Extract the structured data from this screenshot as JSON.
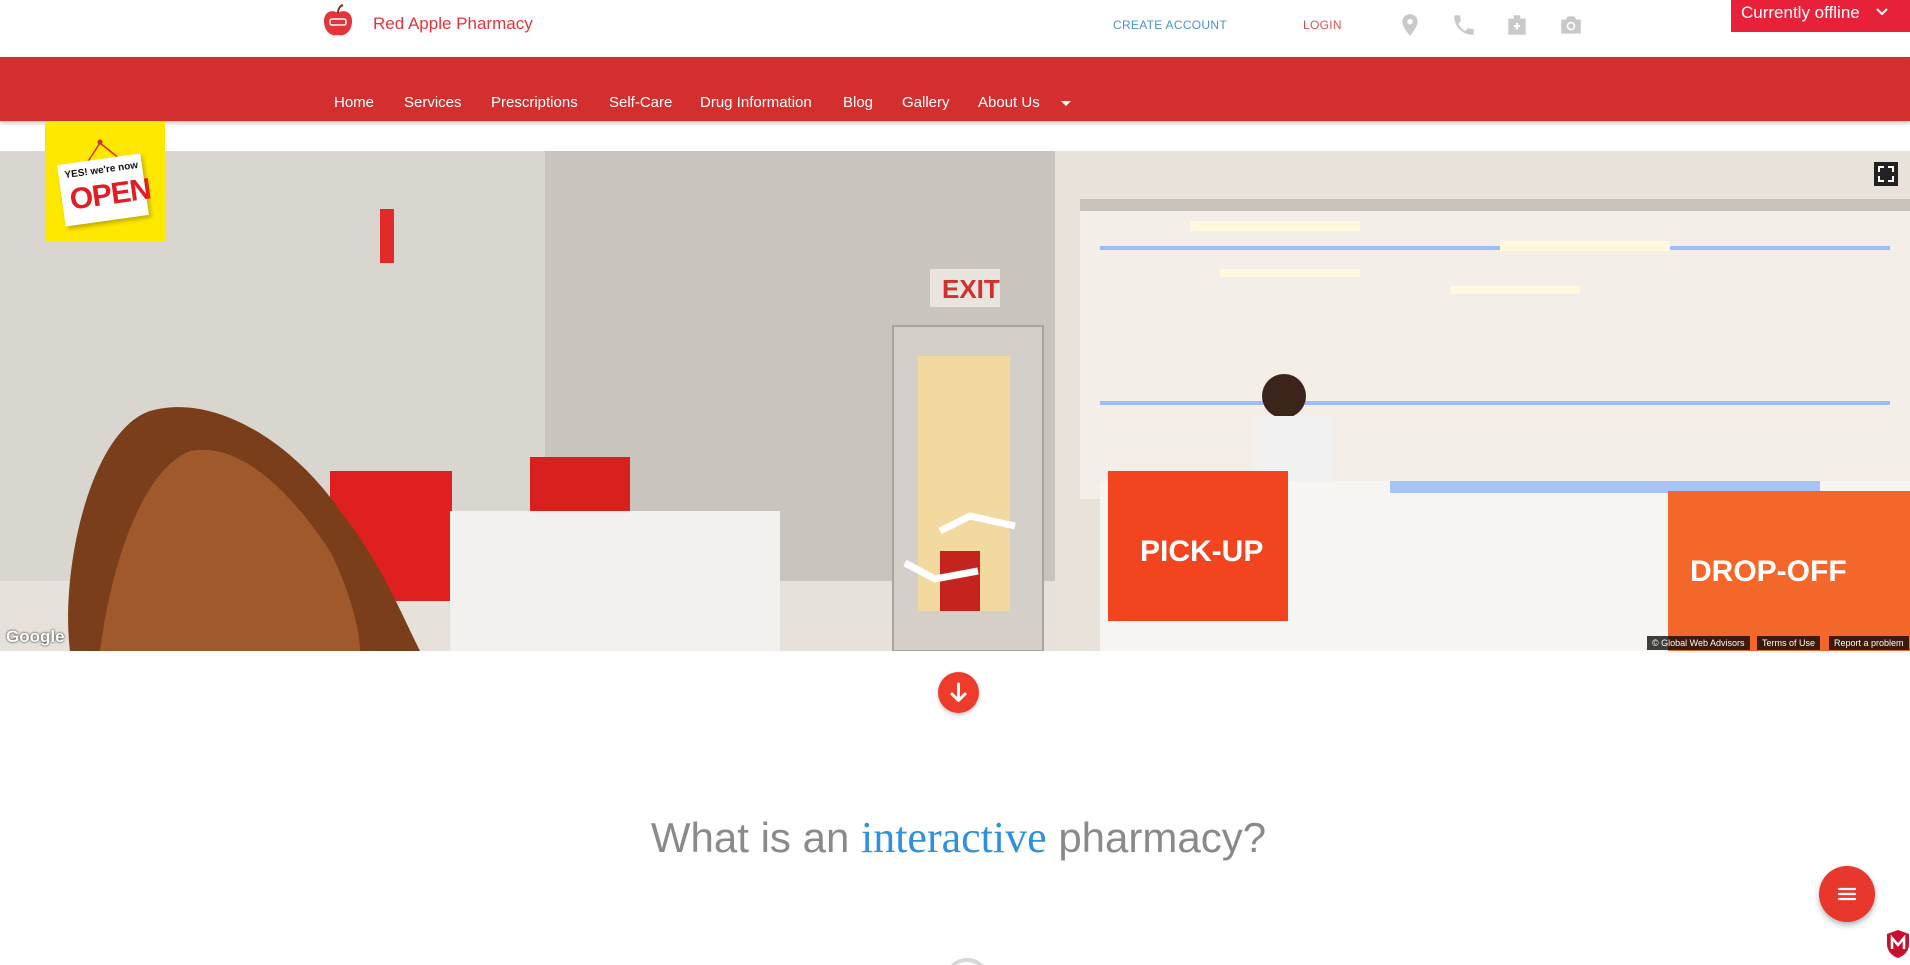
{
  "header": {
    "brand_name": "Red Apple Pharmacy",
    "create_account": "CREATE ACCOUNT",
    "login": "LOGIN",
    "icons": [
      "location-pin-icon",
      "phone-icon",
      "hospital-plus-icon",
      "camera-icon"
    ],
    "chat_status": "Currently offline"
  },
  "nav": {
    "items": [
      "Home",
      "Services",
      "Prescriptions",
      "Self-Care",
      "Drug Information",
      "Blog",
      "Gallery",
      "About Us"
    ]
  },
  "open_sign": {
    "line1": "YES! we're now",
    "line2": "OPEN"
  },
  "hero": {
    "google": "Google",
    "attribution": [
      "© Global Web Advisors",
      "Terms of Use",
      "Report a problem"
    ],
    "signs": [
      "PICK-UP",
      "DROP-OFF"
    ],
    "exit": "EXIT"
  },
  "main": {
    "headline_pre": "What is an",
    "headline_accent": "interactive",
    "headline_post": "pharmacy?"
  },
  "colors": {
    "brand_red": "#d32f2f",
    "accent_blue": "#2f8fe0",
    "chat_red": "#e8213a",
    "fab_red": "#e8372c"
  }
}
